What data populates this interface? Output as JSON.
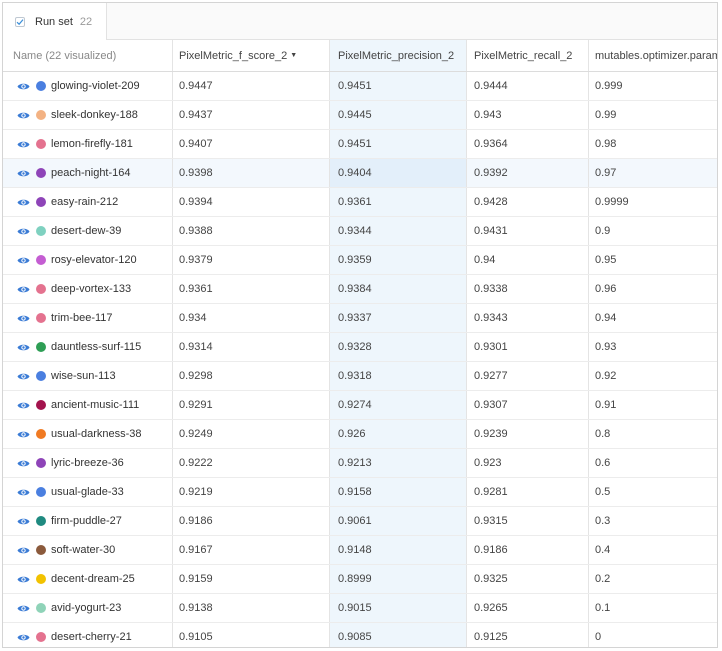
{
  "runset": {
    "label": "Run set",
    "count": "22"
  },
  "columns": {
    "name": "Name (22 visualized)",
    "f_score": "PixelMetric_f_score_2",
    "precision": "PixelMetric_precision_2",
    "recall": "PixelMetric_recall_2",
    "optimizer": "mutables.optimizer.param"
  },
  "sort_indicator": "▼",
  "highlighted_row": 3,
  "rows": [
    {
      "name": "glowing-violet-209",
      "color": "#4a7fe0",
      "f": "0.9447",
      "p": "0.9451",
      "r": "0.9444",
      "o": "0.999"
    },
    {
      "name": "sleek-donkey-188",
      "color": "#f3b283",
      "f": "0.9437",
      "p": "0.9445",
      "r": "0.943",
      "o": "0.99"
    },
    {
      "name": "lemon-firefly-181",
      "color": "#e4728f",
      "f": "0.9407",
      "p": "0.9451",
      "r": "0.9364",
      "o": "0.98"
    },
    {
      "name": "peach-night-164",
      "color": "#8e44b8",
      "f": "0.9398",
      "p": "0.9404",
      "r": "0.9392",
      "o": "0.97"
    },
    {
      "name": "easy-rain-212",
      "color": "#8e44b8",
      "f": "0.9394",
      "p": "0.9361",
      "r": "0.9428",
      "o": "0.9999"
    },
    {
      "name": "desert-dew-39",
      "color": "#7fd1c0",
      "f": "0.9388",
      "p": "0.9344",
      "r": "0.9431",
      "o": "0.9"
    },
    {
      "name": "rosy-elevator-120",
      "color": "#c45dd2",
      "f": "0.9379",
      "p": "0.9359",
      "r": "0.94",
      "o": "0.95"
    },
    {
      "name": "deep-vortex-133",
      "color": "#e4728f",
      "f": "0.9361",
      "p": "0.9384",
      "r": "0.9338",
      "o": "0.96"
    },
    {
      "name": "trim-bee-117",
      "color": "#e4728f",
      "f": "0.934",
      "p": "0.9337",
      "r": "0.9343",
      "o": "0.94"
    },
    {
      "name": "dauntless-surf-115",
      "color": "#2e9e55",
      "f": "0.9314",
      "p": "0.9328",
      "r": "0.9301",
      "o": "0.93"
    },
    {
      "name": "wise-sun-113",
      "color": "#4a7fe0",
      "f": "0.9298",
      "p": "0.9318",
      "r": "0.9277",
      "o": "0.92"
    },
    {
      "name": "ancient-music-111",
      "color": "#a3134d",
      "f": "0.9291",
      "p": "0.9274",
      "r": "0.9307",
      "o": "0.91"
    },
    {
      "name": "usual-darkness-38",
      "color": "#f07a22",
      "f": "0.9249",
      "p": "0.926",
      "r": "0.9239",
      "o": "0.8"
    },
    {
      "name": "lyric-breeze-36",
      "color": "#8e44b8",
      "f": "0.9222",
      "p": "0.9213",
      "r": "0.923",
      "o": "0.6"
    },
    {
      "name": "usual-glade-33",
      "color": "#4a7fe0",
      "f": "0.9219",
      "p": "0.9158",
      "r": "0.9281",
      "o": "0.5"
    },
    {
      "name": "firm-puddle-27",
      "color": "#1f8a80",
      "f": "0.9186",
      "p": "0.9061",
      "r": "0.9315",
      "o": "0.3"
    },
    {
      "name": "soft-water-30",
      "color": "#8b5a3c",
      "f": "0.9167",
      "p": "0.9148",
      "r": "0.9186",
      "o": "0.4"
    },
    {
      "name": "decent-dream-25",
      "color": "#f2c200",
      "f": "0.9159",
      "p": "0.8999",
      "r": "0.9325",
      "o": "0.2"
    },
    {
      "name": "avid-yogurt-23",
      "color": "#8fd3b8",
      "f": "0.9138",
      "p": "0.9015",
      "r": "0.9265",
      "o": "0.1"
    },
    {
      "name": "desert-cherry-21",
      "color": "#e4728f",
      "f": "0.9105",
      "p": "0.9085",
      "r": "0.9125",
      "o": "0"
    }
  ]
}
